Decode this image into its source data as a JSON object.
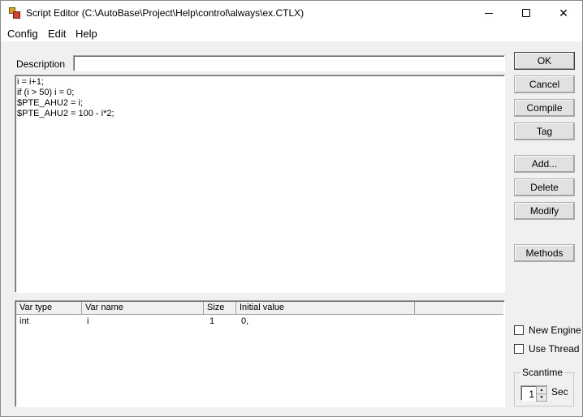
{
  "window": {
    "title": "Script Editor (C:\\AutoBase\\Project\\Help\\control\\always\\ex.CTLX)",
    "controls": {
      "close_glyph": "✕"
    }
  },
  "menu": {
    "config": "Config",
    "edit": "Edit",
    "help": "Help"
  },
  "description": {
    "label": "Description",
    "value": ""
  },
  "script": {
    "lines": [
      "i = i+1;",
      "if (i > 50) i = 0;",
      "$PTE_AHU2 = i;",
      "$PTE_AHU2 = 100 - i*2;"
    ]
  },
  "variables": {
    "columns": [
      "Var type",
      "Var name",
      "Size",
      "Initial value"
    ],
    "rows": [
      {
        "type": "int",
        "name": "i",
        "size": "1",
        "initial": "0,"
      }
    ]
  },
  "buttons": {
    "ok": "OK",
    "cancel": "Cancel",
    "compile": "Compile",
    "tag": "Tag",
    "add": "Add...",
    "delete": "Delete",
    "modify": "Modify",
    "methods": "Methods"
  },
  "options": {
    "new_engine": {
      "label": "New Engine",
      "checked": false
    },
    "use_thread": {
      "label": "Use Thread",
      "checked": false
    }
  },
  "scantime": {
    "label": "Scantime",
    "value": "1",
    "unit": "Sec",
    "up_glyph": "▲",
    "down_glyph": "▼"
  },
  "icons": [
    "app-icon",
    "minimize-icon",
    "maximize-icon",
    "close-icon",
    "spin-up-icon",
    "spin-down-icon"
  ]
}
